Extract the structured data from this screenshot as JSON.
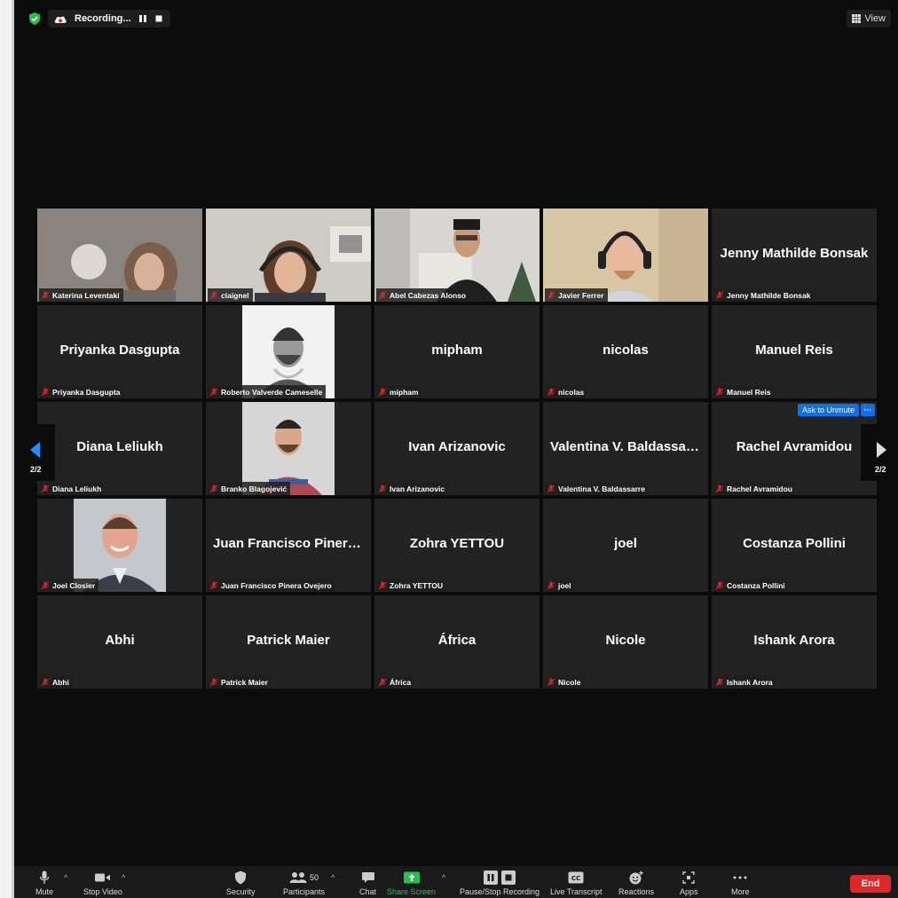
{
  "top_bar": {
    "recording_label": "Recording...",
    "view_label": "View"
  },
  "participants": [
    {
      "name": "Katerina Leventaki",
      "display": "",
      "video": "woman-curly"
    },
    {
      "name": "claignel",
      "display": "",
      "video": "woman-headset"
    },
    {
      "name": "Abel Cabezas Alonso",
      "display": "",
      "video": "man-glasses"
    },
    {
      "name": "Javier Ferrer",
      "display": "",
      "video": "man-headphones"
    },
    {
      "name": "Jenny Mathilde Bonsak",
      "display": "Jenny Mathilde Bonsak",
      "video": ""
    },
    {
      "name": "Priyanka Dasgupta",
      "display": "Priyanka Dasgupta",
      "video": ""
    },
    {
      "name": "Roberto Valverde Cameselle",
      "display": "",
      "video": "bw-portrait"
    },
    {
      "name": "mipham",
      "display": "mipham",
      "video": ""
    },
    {
      "name": "nicolas",
      "display": "nicolas",
      "video": ""
    },
    {
      "name": "Manuel Reis",
      "display": "Manuel Reis",
      "video": ""
    },
    {
      "name": "Diana Leliukh",
      "display": "Diana Leliukh",
      "video": ""
    },
    {
      "name": "Branko Blagojević",
      "display": "",
      "video": "portrait-beard"
    },
    {
      "name": "Ivan Arizanovic",
      "display": "Ivan Arizanovic",
      "video": ""
    },
    {
      "name": "Valentina V. Baldassarre",
      "display": "Valentina V. Baldassarre",
      "video": ""
    },
    {
      "name": "Rachel Avramidou",
      "display": "Rachel Avramidou",
      "video": "",
      "ask_unmute": "Ask to Unmute"
    },
    {
      "name": "Joel Closier",
      "display": "",
      "video": "portrait-smile"
    },
    {
      "name": "Juan Francisco Pinera Ovejero",
      "display": "Juan Francisco Pinera Ov...",
      "video": ""
    },
    {
      "name": "Zohra YETTOU",
      "display": "Zohra YETTOU",
      "video": ""
    },
    {
      "name": "joel",
      "display": "joel",
      "video": ""
    },
    {
      "name": "Costanza Pollini",
      "display": "Costanza Pollini",
      "video": ""
    },
    {
      "name": "Abhi",
      "display": "Abhi",
      "video": ""
    },
    {
      "name": "Patrick Maier",
      "display": "Patrick Maier",
      "video": ""
    },
    {
      "name": "África",
      "display": "África",
      "video": ""
    },
    {
      "name": "Nicole",
      "display": "Nicole",
      "video": ""
    },
    {
      "name": "Ishank Arora",
      "display": "Ishank Arora",
      "video": ""
    }
  ],
  "pager": {
    "left_page": "2/2",
    "right_page": "2/2"
  },
  "toolbar": {
    "mute": "Mute",
    "stop_video": "Stop Video",
    "security": "Security",
    "participants": "Participants",
    "participants_count": "50",
    "chat": "Chat",
    "share_screen": "Share Screen",
    "pause_stop_recording": "Pause/Stop Recording",
    "live_transcript": "Live Transcript",
    "reactions": "Reactions",
    "apps": "Apps",
    "more": "More",
    "end": "End"
  },
  "colors": {
    "accent_blue": "#0e71eb",
    "share_green": "#25c150",
    "end_red": "#e02828",
    "mic_off_red": "#e02828"
  }
}
